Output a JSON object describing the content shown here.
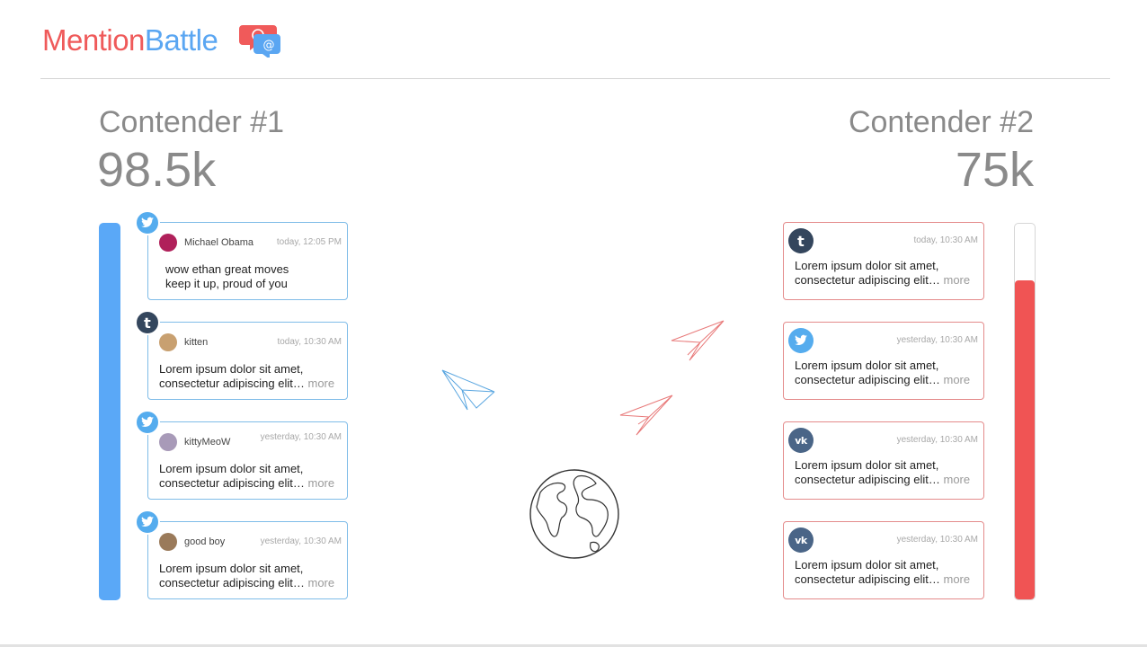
{
  "app": {
    "brand_part1": "Mention",
    "brand_part2": "Battle"
  },
  "colors": {
    "contender1": "#5aa8f7",
    "contender2": "#f05454",
    "twitter": "#55acee",
    "tumblr": "#34465d",
    "vk": "#4a6587"
  },
  "contender1": {
    "label": "Contender #1",
    "score": "98.5k",
    "bar_fill_percent": 100,
    "mentions": [
      {
        "network": "twitter",
        "user": "Michael Obama",
        "time": "today, 12:05 PM",
        "text": "wow ethan great moves\nkeep it up, proud of you",
        "more": ""
      },
      {
        "network": "tumblr",
        "user": "kitten",
        "time": "today, 10:30 AM",
        "text": "Lorem ipsum dolor sit amet,\nconsectetur adipiscing elit…",
        "more": "more"
      },
      {
        "network": "twitter",
        "user": "kittyMeoW",
        "time": "yesterday, 10:30 AM",
        "text": "Lorem ipsum dolor sit amet,\nconsectetur adipiscing elit…",
        "more": "more"
      },
      {
        "network": "twitter",
        "user": "good boy",
        "time": "yesterday, 10:30 AM",
        "text": "Lorem ipsum dolor sit amet,\nconsectetur adipiscing elit…",
        "more": "more"
      }
    ]
  },
  "contender2": {
    "label": "Contender #2",
    "score": "75k",
    "bar_fill_percent": 85,
    "mentions": [
      {
        "network": "tumblr",
        "time": "today, 10:30 AM",
        "text": "Lorem ipsum dolor sit amet,\nconsectetur adipiscing elit…",
        "more": "more"
      },
      {
        "network": "twitter",
        "time": "yesterday, 10:30 AM",
        "text": "Lorem ipsum dolor sit amet,\nconsectetur adipiscing elit…",
        "more": "more"
      },
      {
        "network": "vk",
        "time": "yesterday, 10:30 AM",
        "text": "Lorem ipsum dolor sit amet,\nconsectetur adipiscing elit…",
        "more": "more"
      },
      {
        "network": "vk",
        "time": "yesterday, 10:30 AM",
        "text": "Lorem ipsum dolor sit amet,\nconsectetur adipiscing elit…",
        "more": "more"
      }
    ]
  },
  "decor": {
    "planes": [
      "paper-plane-icon",
      "paper-plane-icon",
      "paper-plane-icon"
    ],
    "globe": "globe-icon",
    "logo": "chat-bubbles-icon"
  }
}
